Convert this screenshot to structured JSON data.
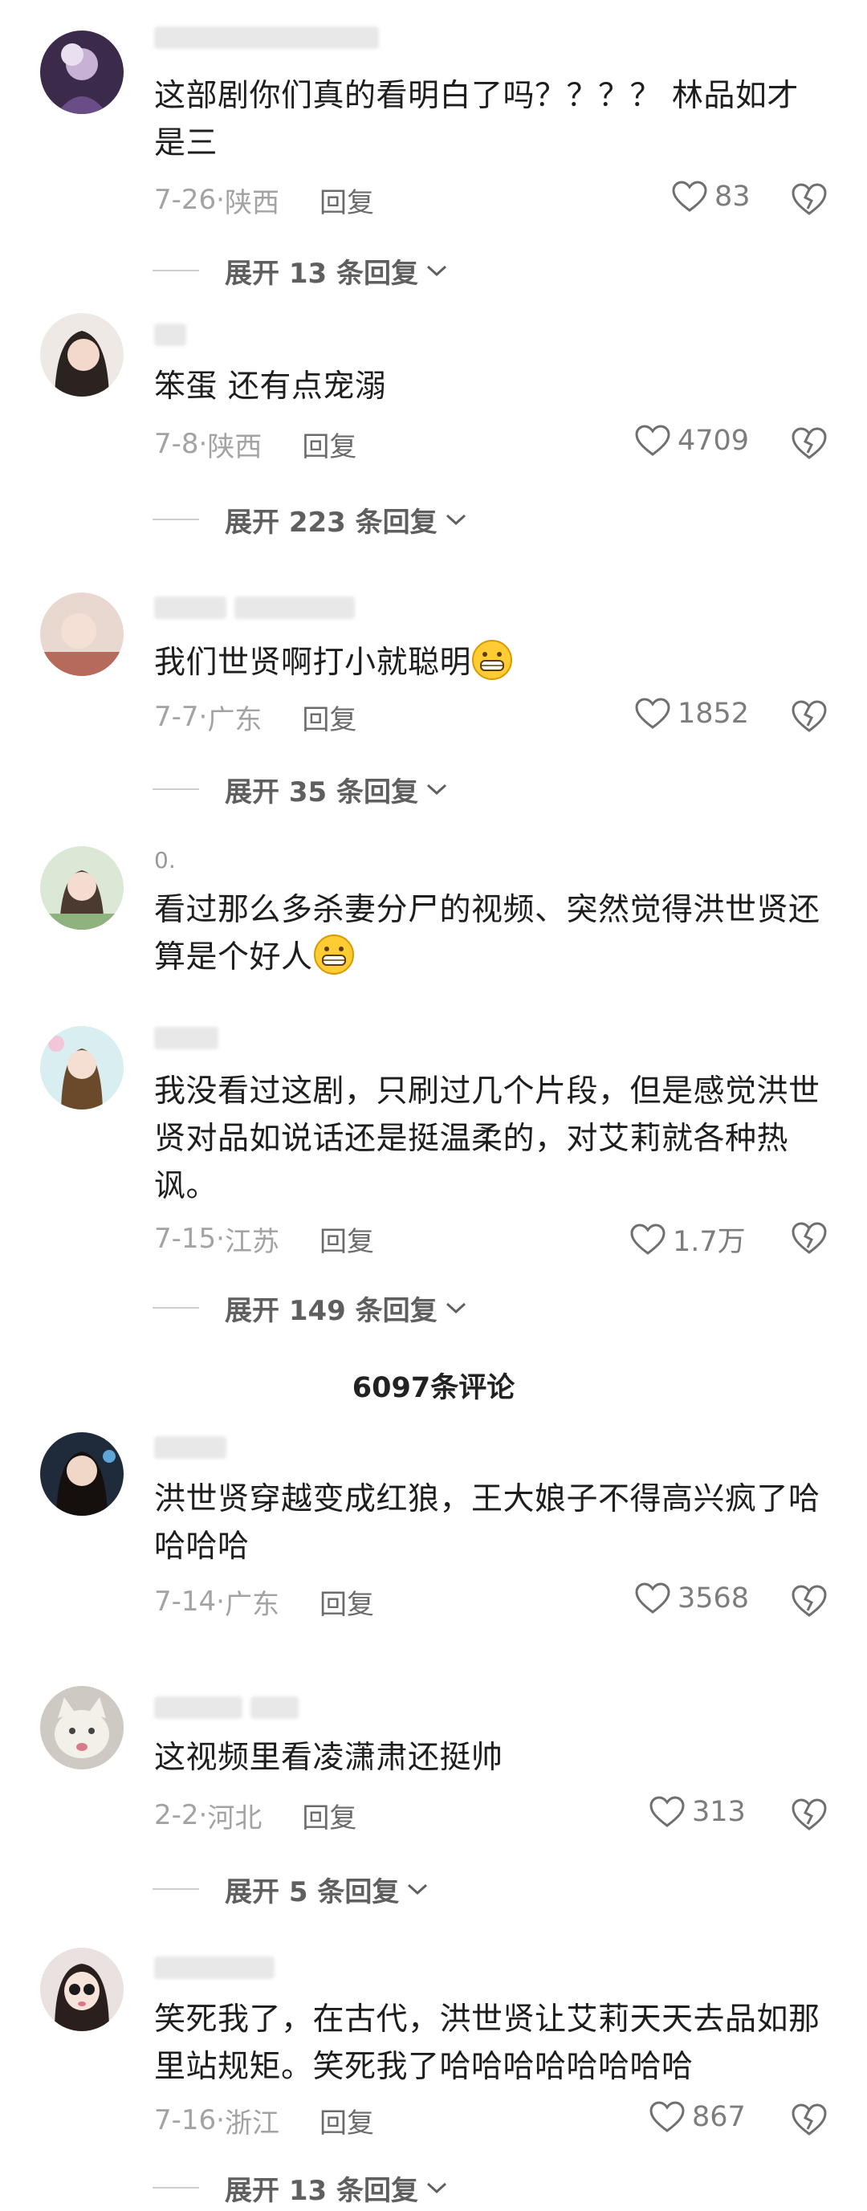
{
  "comments": [
    {
      "username": "",
      "text": "这部剧你们真的看明白了吗？？？？ 林品如才是三",
      "date": "7-26",
      "region": "陕西",
      "reply": "回复",
      "likes": "83",
      "expand": "展开 13 条回复"
    },
    {
      "username": "",
      "text": "笨蛋 还有点宠溺",
      "date": "7-8",
      "region": "陕西",
      "reply": "回复",
      "likes": "4709",
      "expand": "展开 223 条回复"
    },
    {
      "username": "",
      "text": "我们世贤啊打小就聪明",
      "date": "7-7",
      "region": "广东",
      "reply": "回复",
      "likes": "1852",
      "expand": "展开 35 条回复"
    },
    {
      "username": "0.",
      "text": "看过那么多杀妻分尸的视频、突然觉得洪世贤还算是个好人"
    },
    {
      "username": "",
      "text": "我没看过这剧，只刷过几个片段，但是感觉洪世贤对品如说话还是挺温柔的，对艾莉就各种热讽。",
      "date": "7-15",
      "region": "江苏",
      "reply": "回复",
      "likes": "1.7万",
      "expand": "展开 149 条回复"
    },
    {
      "username": "",
      "text": "洪世贤穿越变成红狼，王大娘子不得高兴疯了哈哈哈哈",
      "date": "7-14",
      "region": "广东",
      "reply": "回复",
      "likes": "3568"
    },
    {
      "username": "",
      "text": "这视频里看凌潇肃还挺帅",
      "date": "2-2",
      "region": "河北",
      "reply": "回复",
      "likes": "313",
      "expand": "展开 5 条回复"
    },
    {
      "username": "",
      "text": "笑死我了，在古代，洪世贤让艾莉天天去品如那里站规矩。笑死我了哈哈哈哈哈哈哈哈",
      "date": "7-16",
      "region": "浙江",
      "reply": "回复",
      "likes": "867",
      "expand": "展开 13 条回复"
    }
  ],
  "total_comments": "6097条评论",
  "icons": {
    "like": "heart-outline-icon",
    "dislike": "broken-heart-icon",
    "expand": "chevron-down-icon",
    "emoji": "grinning-face-emoji"
  }
}
